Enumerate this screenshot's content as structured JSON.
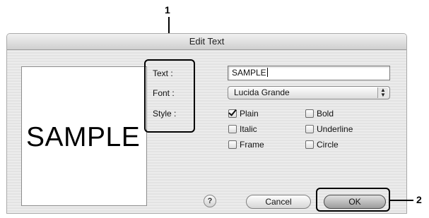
{
  "dialog": {
    "title": "Edit Text",
    "preview_text": "SAMPLE",
    "labels": {
      "text": "Text :",
      "font": "Font :",
      "style": "Style :"
    },
    "text_value": "SAMPLE",
    "font_value": "Lucida Grande",
    "styles": [
      {
        "label": "Plain",
        "checked": true
      },
      {
        "label": "Bold",
        "checked": false
      },
      {
        "label": "Italic",
        "checked": false
      },
      {
        "label": "Underline",
        "checked": false
      },
      {
        "label": "Frame",
        "checked": false
      },
      {
        "label": "Circle",
        "checked": false
      }
    ],
    "help_label": "?",
    "cancel_label": "Cancel",
    "ok_label": "OK"
  },
  "callouts": {
    "one": "1",
    "two": "2"
  },
  "icons": {
    "popup_arrows": "up-down-arrows-icon",
    "help": "question-mark-icon",
    "check": "checkmark-icon"
  }
}
